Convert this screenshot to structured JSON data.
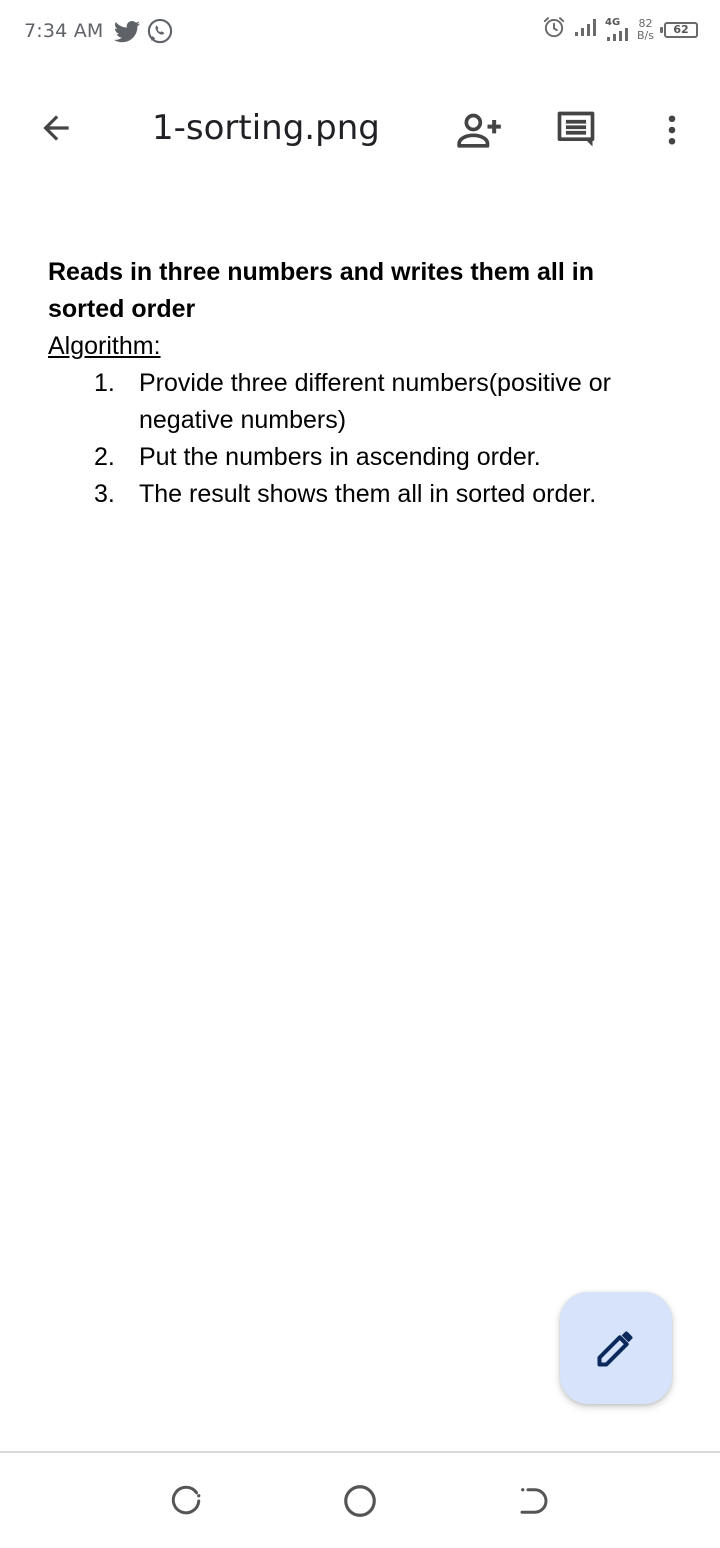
{
  "status_bar": {
    "time": "7:34 AM",
    "app_icons": [
      "twitter-icon",
      "whatsapp-icon"
    ],
    "network_label": "4G",
    "net_speed_value": "82",
    "net_speed_unit": "B/s",
    "battery_level": "62"
  },
  "toolbar": {
    "title": "1-sorting.png",
    "icons": [
      "back-arrow-icon",
      "add-person-icon",
      "comments-icon",
      "more-vert-icon"
    ]
  },
  "document": {
    "heading_line1": "Reads in three numbers and writes them all in",
    "heading_line2": "sorted order",
    "subheading": "Algorithm:",
    "steps": [
      {
        "number": "1.",
        "line1": "Provide three different numbers(positive or",
        "line2": "negative numbers)"
      },
      {
        "number": "2.",
        "line1": "Put the numbers in ascending order."
      },
      {
        "number": "3.",
        "line1": "The result shows them all in sorted order."
      }
    ]
  },
  "fab": {
    "icon": "pencil-icon"
  },
  "nav_bar": {
    "icons": [
      "recent-apps-icon",
      "home-icon",
      "back-icon"
    ]
  },
  "colors": {
    "fab_background": "#d6e3fb",
    "fab_icon": "#0b2a5b",
    "text": "#000000",
    "toolbar_icon": "#444444"
  }
}
